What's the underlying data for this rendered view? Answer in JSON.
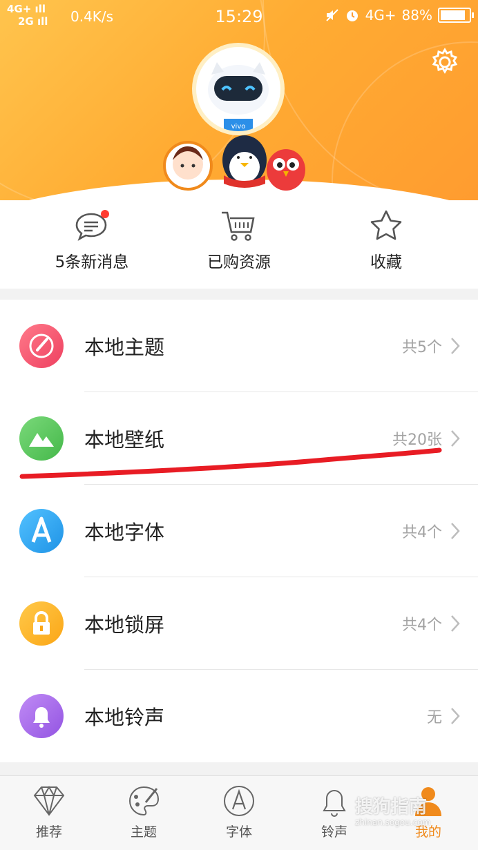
{
  "status_bar": {
    "signal_top": "4G+",
    "signal_bottom": "2G",
    "speed": "0.4K/s",
    "time": "15:29",
    "network": "4G+",
    "battery": "88%",
    "battery_level": 0.88
  },
  "header": {
    "settings_icon": "gear-icon",
    "avatar_icon": "robot-mascot-icon"
  },
  "quick_actions": [
    {
      "label": "5条新消息",
      "icon": "message-icon",
      "badge": true
    },
    {
      "label": "已购资源",
      "icon": "cart-icon"
    },
    {
      "label": "收藏",
      "icon": "star-icon"
    }
  ],
  "local_items": [
    {
      "title": "本地主题",
      "count": "共5个",
      "icon": "brush-icon",
      "color": "#f2566e"
    },
    {
      "title": "本地壁纸",
      "count": "共20张",
      "icon": "mountain-icon",
      "color": "#5cc95f"
    },
    {
      "title": "本地字体",
      "count": "共4个",
      "icon": "letter-a-icon",
      "color": "#2ea6ef"
    },
    {
      "title": "本地锁屏",
      "count": "共4个",
      "icon": "lock-icon",
      "color": "#ffb526"
    },
    {
      "title": "本地铃声",
      "count": "无",
      "icon": "bell-icon",
      "color": "#a865e8"
    }
  ],
  "tab_bar": [
    {
      "label": "推荐",
      "icon": "diamond-icon",
      "active": false
    },
    {
      "label": "主题",
      "icon": "palette-icon",
      "active": false
    },
    {
      "label": "字体",
      "icon": "font-icon",
      "active": false
    },
    {
      "label": "铃声",
      "icon": "bell-icon",
      "active": false
    },
    {
      "label": "我的",
      "icon": "user-icon",
      "active": true
    }
  ],
  "colors": {
    "accent": "#f08a1c",
    "header_start": "#ffc44d",
    "header_end": "#ff9b2f",
    "annotation": "#e81c24"
  },
  "watermark": {
    "text": "搜狗指南",
    "url": "zhinan.sogou.com"
  }
}
